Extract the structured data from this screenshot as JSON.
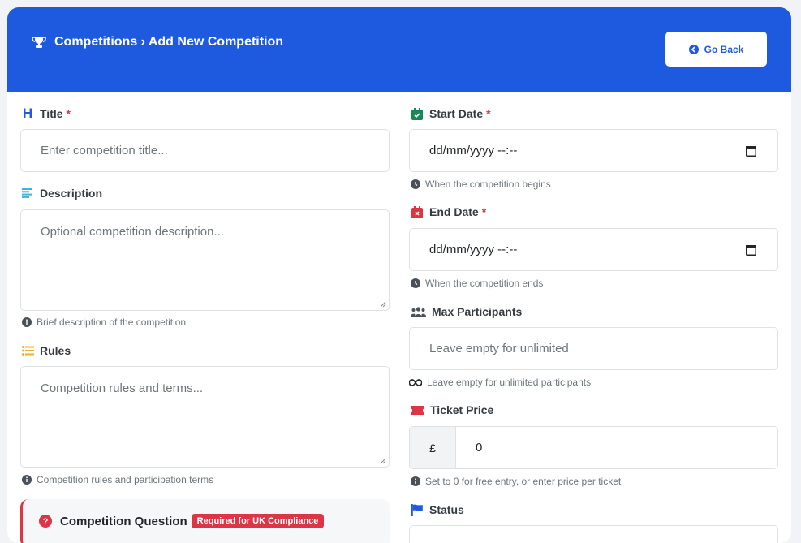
{
  "header": {
    "breadcrumb": "Competitions › Add New Competition",
    "go_back": "Go Back"
  },
  "left": {
    "title": {
      "label": "Title",
      "required": "*",
      "placeholder": "Enter competition title..."
    },
    "description": {
      "label": "Description",
      "placeholder": "Optional competition description...",
      "help": "Brief description of the competition"
    },
    "rules": {
      "label": "Rules",
      "placeholder": "Competition rules and terms...",
      "help": "Competition rules and participation terms"
    },
    "question": {
      "label": "Competition Question",
      "badge": "Required for UK Compliance"
    }
  },
  "right": {
    "start_date": {
      "label": "Start Date",
      "required": "*",
      "value": "dd/mm/yyyy --:--",
      "help": "When the competition begins"
    },
    "end_date": {
      "label": "End Date",
      "required": "*",
      "value": "dd/mm/yyyy --:--",
      "help": "When the competition ends"
    },
    "max_participants": {
      "label": "Max Participants",
      "placeholder": "Leave empty for unlimited",
      "help": "Leave empty for unlimited participants"
    },
    "ticket_price": {
      "label": "Ticket Price",
      "prefix": "£",
      "value": "0",
      "help": "Set to 0 for free entry, or enter price per ticket"
    },
    "status": {
      "label": "Status"
    }
  },
  "colors": {
    "primary": "#1e5ae0",
    "danger": "#dc3545",
    "success": "#198754",
    "warning": "#f0ad2e",
    "info": "#3bb6d8"
  }
}
